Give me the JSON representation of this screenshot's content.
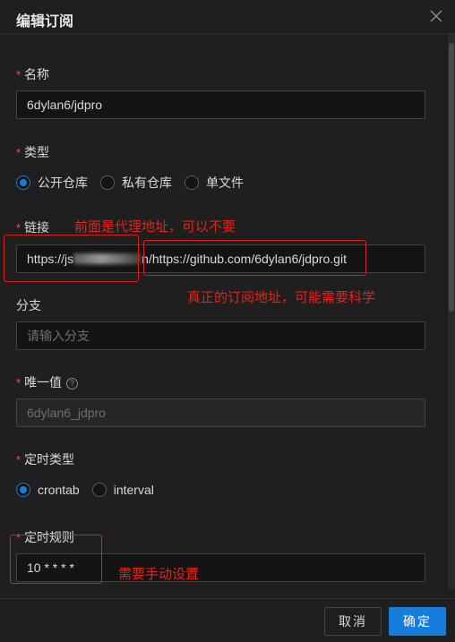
{
  "modal": {
    "title": "编辑订阅",
    "required_mark": "*"
  },
  "fields": {
    "name": {
      "label": "名称",
      "value": "6dylan6/jdpro"
    },
    "type": {
      "label": "类型",
      "options": [
        "公开仓库",
        "私有仓库",
        "单文件"
      ],
      "selected": "公开仓库"
    },
    "link": {
      "label": "链接",
      "value_prefix": "https://js",
      "value_hidden_tail": "n",
      "value_suffix": "/https://github.com/6dylan6/jdpro.git"
    },
    "branch": {
      "label": "分支",
      "placeholder": "请输入分支"
    },
    "unique": {
      "label": "唯一值",
      "help": "?",
      "value": "6dylan6_jdpro"
    },
    "schedule_type": {
      "label": "定时类型",
      "options": [
        "crontab",
        "interval"
      ],
      "selected": "crontab"
    },
    "schedule_rule": {
      "label": "定时规则",
      "value": "10 * * * *"
    }
  },
  "annotations": {
    "proxy_note": "前面是代理地址，可以不要",
    "real_note": "真正的订阅地址，可能需要科学",
    "cron_note": "需要手动设置"
  },
  "footer": {
    "cancel_label": "取消",
    "ok_label": "确定"
  },
  "colors": {
    "accent": "#177ddc",
    "annotation": "#e2231a",
    "background": "#1f1f1f"
  }
}
